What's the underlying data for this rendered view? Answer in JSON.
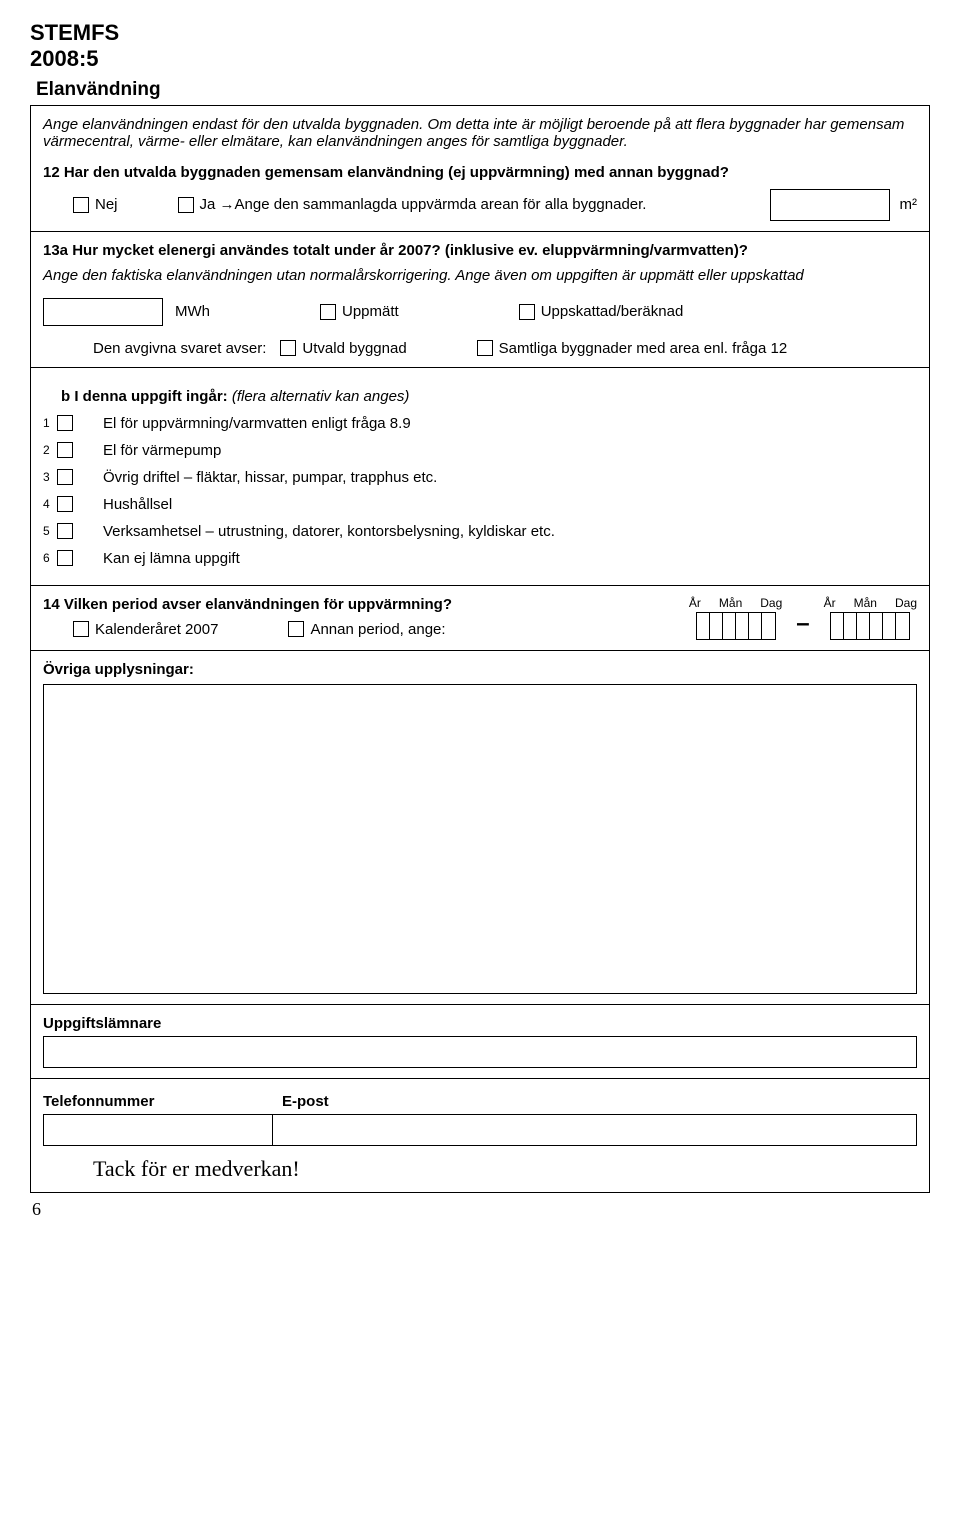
{
  "header": {
    "line1": "STEMFS",
    "line2": "2008:5"
  },
  "elanv": "Elanvändning",
  "box1": {
    "intro": "Ange elanvändningen endast för den utvalda byggnaden. Om detta inte är möjligt beroende på att flera byggnader har gemensam värmecentral, värme- eller elmätare, kan elanvändningen anges för samtliga byggnader.",
    "q12": "12 Har den utvalda byggnaden gemensam elanvändning (ej uppvärmning) med annan byggnad?",
    "nej": "Nej",
    "ja": "Ja →Ange den sammanlagda uppvärmda arean för alla byggnader.",
    "m2": "m²"
  },
  "box2": {
    "q13a": "13a Hur mycket elenergi användes totalt under år 2007?  (inklusive ev. eluppvärmning/varmvatten)?",
    "sub": "Ange den faktiska elanvändningen utan normalårskorrigering. Ange även om uppgiften är uppmätt eller uppskattad",
    "mwh": "MWh",
    "uppm": "Uppmätt",
    "uppsk": "Uppskattad/beräknad",
    "avser": "Den avgivna svaret  avser:",
    "utvald": "Utvald byggnad",
    "samt": "Samtliga byggnader med area enl. fråga 12"
  },
  "box3": {
    "title": "b I denna uppgift ingår: (flera alternativ kan anges)",
    "items": [
      "El för uppvärmning/varmvatten enligt fråga 8.9",
      "El för värmepump",
      "Övrig driftel – fläktar, hissar, pumpar, trapphus etc.",
      "Hushållsel",
      "Verksamhetsel – utrustning, datorer, kontorsbelysning, kyldiskar etc.",
      "Kan ej lämna uppgift"
    ]
  },
  "box4": {
    "q14": "14 Vilken period avser elanvändningen för uppvärmning?",
    "kal": "Kalenderåret 2007",
    "annan": "Annan period, ange:",
    "ar": "År",
    "man": "Mån",
    "dag": "Dag"
  },
  "ovriga": "Övriga upplysningar:",
  "uppg": "Uppgiftslämnare",
  "tel": "Telefonnummer",
  "epost": "E-post",
  "tack": "Tack för er medverkan!",
  "pagenum": "6"
}
